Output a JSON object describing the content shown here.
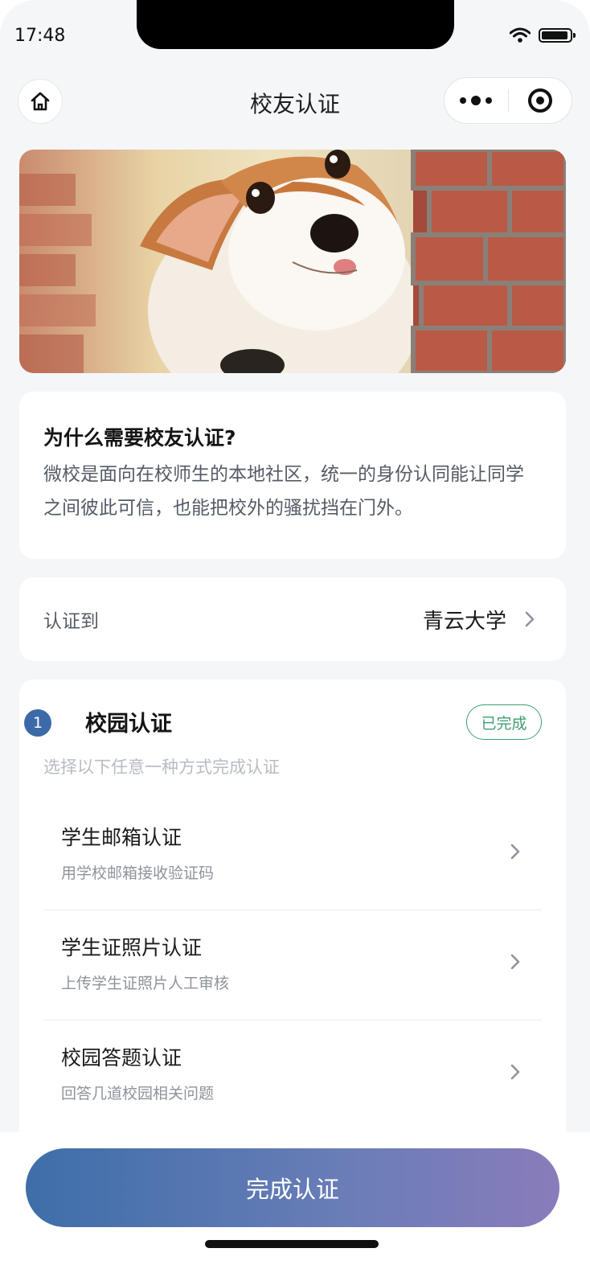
{
  "status_bar": {
    "time": "17:48"
  },
  "nav": {
    "title": "校友认证",
    "home_icon": "home-icon",
    "more_icon": "more-dots-icon",
    "close_icon": "target-close-icon"
  },
  "why_card": {
    "title": "为什么需要校友认证?",
    "body": "微校是面向在校师生的本地社区，统一的身份认同能让同学之间彼此可信，也能把校外的骚扰挡在门外。"
  },
  "school_row": {
    "label": "认证到",
    "value": "青云大学"
  },
  "campus_section": {
    "step": "1",
    "title": "校园认证",
    "status": "已完成",
    "subtitle": "选择以下任意一种方式完成认证",
    "methods": [
      {
        "title": "学生邮箱认证",
        "subtitle": "用学校邮箱接收验证码"
      },
      {
        "title": "学生证照片认证",
        "subtitle": "上传学生证照片人工审核"
      },
      {
        "title": "校园答题认证",
        "subtitle": "回答几道校园相关问题"
      }
    ]
  },
  "cta": {
    "label": "完成认证"
  },
  "colors": {
    "accent": "#3c6aa8",
    "success": "#3e9f73",
    "gradient_end": "#8a7cbb"
  }
}
